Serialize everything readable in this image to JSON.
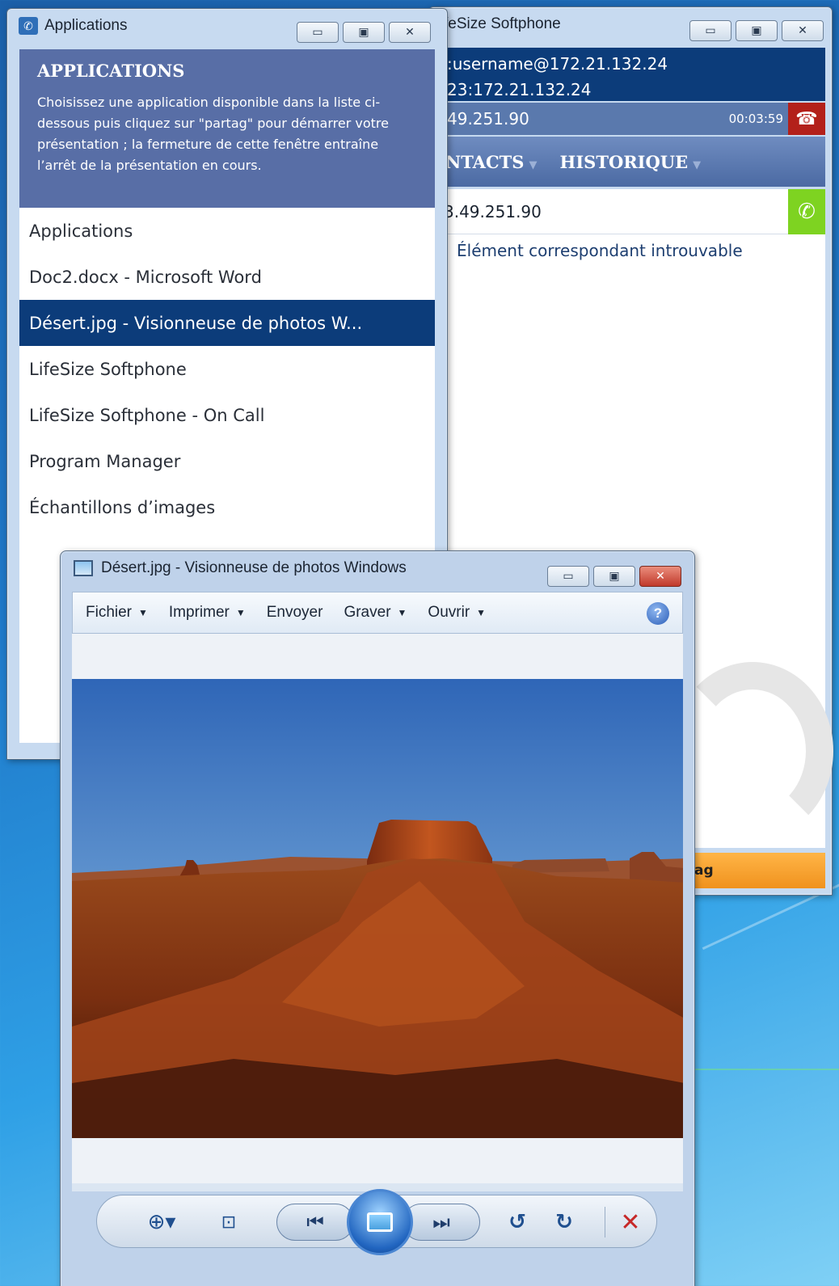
{
  "softphone": {
    "title": "feSize Softphone",
    "controls": {
      "minimize": "▭",
      "maximize": "▣",
      "close": "✕"
    },
    "identity_line1": ":username@172.21.132.24",
    "identity_line2": "23:172.21.132.24",
    "call_address": "49.251.90",
    "call_duration": "00:03:59",
    "nav": {
      "contacts": "NTACTS",
      "history": "HISTORIQUE"
    },
    "search_value": "3.49.251.90",
    "no_match": "Élément correspondant introuvable",
    "bottom_label": "ag",
    "colors": {
      "header": "#0c3c7a",
      "hangup": "#b3201a",
      "call": "#7ed321",
      "footer": "#f0921e"
    }
  },
  "applications": {
    "title": "Applications",
    "header_title": "APPLICATIONS",
    "header_text": "Choisissez une application disponible dans la liste ci-dessous puis cliquez sur \"partag\" pour démarrer votre présentation ; la fermeture de cette fenêtre entraîne l’arrêt de la présentation en cours.",
    "items": [
      {
        "label": "Applications",
        "selected": false
      },
      {
        "label": "Doc2.docx - Microsoft Word",
        "selected": false
      },
      {
        "label": "Désert.jpg - Visionneuse de photos W...",
        "selected": true
      },
      {
        "label": "LifeSize Softphone",
        "selected": false
      },
      {
        "label": "LifeSize Softphone - On Call",
        "selected": false
      },
      {
        "label": "Program Manager",
        "selected": false
      },
      {
        "label": "Échantillons d’images",
        "selected": false
      }
    ]
  },
  "viewer": {
    "title": "Désert.jpg - Visionneuse de photos Windows",
    "menu": {
      "file": "Fichier",
      "print": "Imprimer",
      "send": "Envoyer",
      "burn": "Graver",
      "open": "Ouvrir"
    },
    "help": "?",
    "toolbar_icons": [
      "zoom-icon",
      "actual-size-icon",
      "previous-icon",
      "slideshow-icon",
      "next-icon",
      "rotate-left-icon",
      "rotate-right-icon",
      "delete-icon"
    ]
  }
}
